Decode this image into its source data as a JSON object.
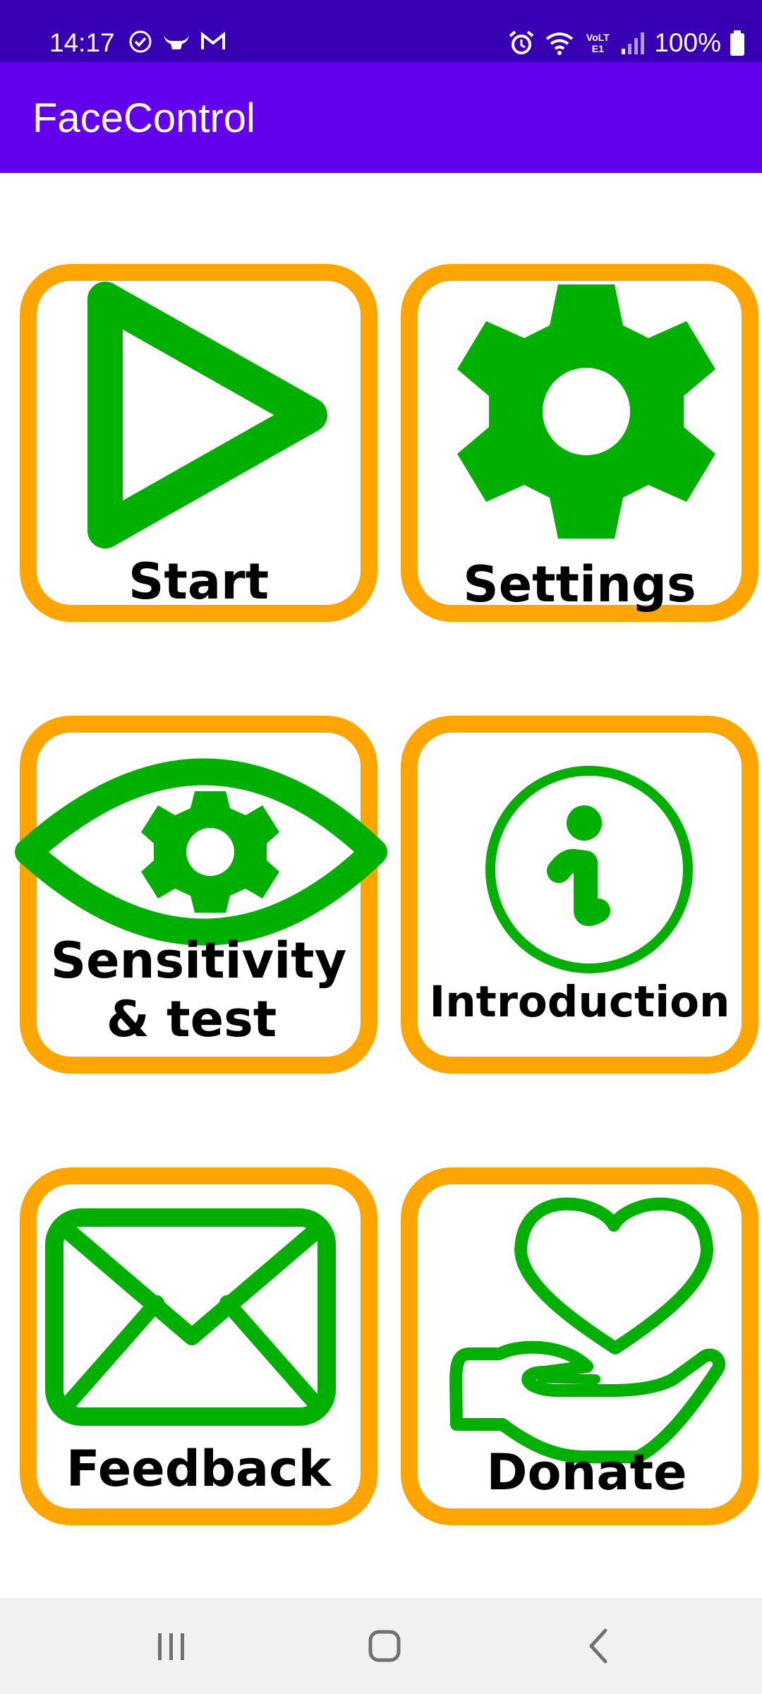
{
  "status_bar": {
    "time": "14:17",
    "battery": "100%",
    "network": "VoLTE1",
    "left_icons": [
      "check-circle-icon",
      "bull-icon",
      "gmail-icon"
    ],
    "right_icons": [
      "alarm-icon",
      "wifi-icon",
      "volte-icon",
      "signal-icon",
      "battery-icon"
    ]
  },
  "app_bar": {
    "title": "FaceControl"
  },
  "tiles": [
    {
      "label": "Start",
      "icon": "play-icon"
    },
    {
      "label": "Settings",
      "icon": "gear-icon"
    },
    {
      "label_line1": "Sensitivity",
      "label_line2": "& test",
      "icon": "eye-gear-icon"
    },
    {
      "label": "Introduction",
      "icon": "info-icon"
    },
    {
      "label": "Feedback",
      "icon": "envelope-icon"
    },
    {
      "label": "Donate",
      "icon": "heart-hand-icon"
    }
  ],
  "colors": {
    "status_bar": "#3700b3",
    "app_bar": "#6200ee",
    "tile_border": "#ffa500",
    "icon_green": "#00b000"
  },
  "nav_bar": {
    "buttons": [
      "recents-button",
      "home-button",
      "back-button"
    ]
  }
}
